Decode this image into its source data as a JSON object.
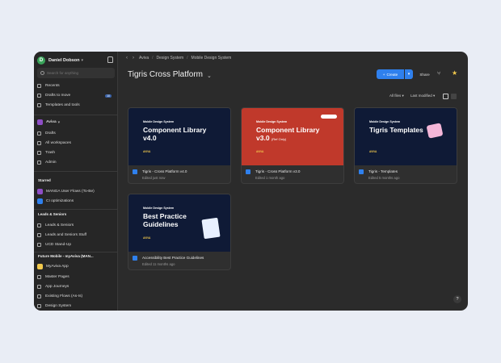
{
  "user": {
    "name": "Daniel Dobson",
    "initial": "D"
  },
  "search": {
    "placeholder": "Search for anything"
  },
  "nav_top": [
    {
      "label": "Recents"
    },
    {
      "label": "Drafts to move",
      "badge": "10"
    },
    {
      "label": "Templates and tools"
    }
  ],
  "org": {
    "name": "Aviva"
  },
  "nav_org": [
    {
      "label": "Drafts"
    },
    {
      "label": "All workspaces"
    },
    {
      "label": "Trash"
    },
    {
      "label": "Admin"
    }
  ],
  "starred": {
    "title": "Starred",
    "items": [
      {
        "label": "MANGA User Flows (To-Be)",
        "color": "#8e4ec6"
      },
      {
        "label": "CI optimizations",
        "color": "#2f80ed"
      }
    ]
  },
  "leads": {
    "title": "Leads & Seniors",
    "items": [
      {
        "label": "Leads & Seniors"
      },
      {
        "label": "Leads and Seniors Stuff"
      },
      {
        "label": "UCD Stand-Up"
      }
    ]
  },
  "future": {
    "title": "Future Mobile - myAviva (MAN...",
    "items": [
      {
        "label": "MyAviva App"
      },
      {
        "label": "Master Pages"
      },
      {
        "label": "App Journeys"
      },
      {
        "label": "Existing Flows (As-Is)"
      },
      {
        "label": "Design System"
      }
    ]
  },
  "breadcrumb": [
    "Aviva",
    "Design System",
    "Mobile Design System"
  ],
  "page_title": "Tigris Cross Platform",
  "toolbar": {
    "create": "Create",
    "share": "Share"
  },
  "filters": {
    "files": "All files",
    "sort": "Last modified"
  },
  "cards": [
    {
      "kicker": "Mobile Design System",
      "heading": "Component Library v4.0",
      "heading_sub": "",
      "brand": "AVIVA",
      "bg": "#0f1a36",
      "name": "Tigris - Cross Platform v4.0",
      "meta": "Edited just now"
    },
    {
      "kicker": "Mobile Design System",
      "heading": "Component Library v3.0",
      "heading_sub": "(Ref Only)",
      "brand": "AVIVA",
      "bg": "#c0392b",
      "name": "Tigris - Cross Platform v3.0",
      "meta": "Edited 1 month ago"
    },
    {
      "kicker": "Mobile Design System",
      "heading": "Tigris Templates",
      "heading_sub": "",
      "brand": "AVIVA",
      "bg": "#0f1a36",
      "name": "Tigris - Templates",
      "meta": "Edited 5 months ago"
    },
    {
      "kicker": "Mobile Design System",
      "heading": "Best Practice Guidelines",
      "heading_sub": "",
      "brand": "AVIVA",
      "bg": "#0f1a36",
      "name": "Accessibility Best Practice Guidelines",
      "meta": "Edited 11 months ago"
    }
  ],
  "help": "?"
}
